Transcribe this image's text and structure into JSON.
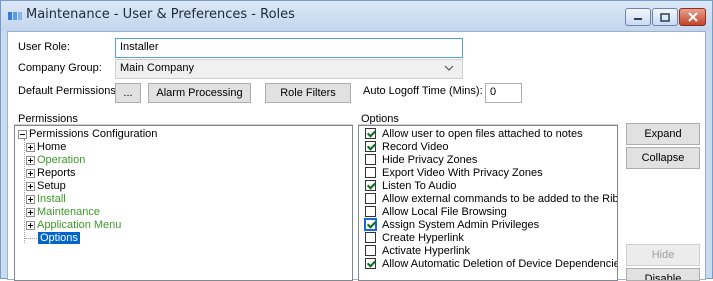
{
  "window": {
    "title": "Maintenance - User & Preferences - Roles",
    "accent": "#c9dbef"
  },
  "form": {
    "user_role_label": "User Role:",
    "user_role_value": "Installer",
    "company_group_label": "Company Group:",
    "company_group_value": "Main Company",
    "default_permissions_label": "Default Permissions",
    "ellipsis_label": "...",
    "alarm_processing_label": "Alarm Processing",
    "role_filters_label": "Role Filters",
    "auto_logoff_label": "Auto Logoff Time (Mins):",
    "auto_logoff_value": "0"
  },
  "permissions": {
    "title": "Permissions",
    "root": "Permissions Configuration",
    "nodes": [
      {
        "label": "Home",
        "green": false
      },
      {
        "label": "Operation",
        "green": true
      },
      {
        "label": "Reports",
        "green": false
      },
      {
        "label": "Setup",
        "green": false
      },
      {
        "label": "Install",
        "green": true
      },
      {
        "label": "Maintenance",
        "green": true
      },
      {
        "label": "Application Menu",
        "green": true
      }
    ],
    "selected": "Options"
  },
  "options": {
    "title": "Options",
    "items": [
      {
        "label": "Allow user to open files attached to notes",
        "checked": true
      },
      {
        "label": "Record Video",
        "checked": true
      },
      {
        "label": "Hide Privacy Zones",
        "checked": false
      },
      {
        "label": "Export Video With Privacy Zones",
        "checked": false
      },
      {
        "label": "Listen To Audio",
        "checked": true
      },
      {
        "label": "Allow external commands to be added to the Ribbon Bar",
        "checked": false
      },
      {
        "label": "Allow Local File Browsing",
        "checked": false
      },
      {
        "label": "Assign System Admin Privileges",
        "checked": true
      },
      {
        "label": "Create Hyperlink",
        "checked": false
      },
      {
        "label": "Activate Hyperlink",
        "checked": false
      },
      {
        "label": "Allow Automatic Deletion of Device Dependencies",
        "checked": true
      }
    ]
  },
  "side_buttons": {
    "expand": "Expand",
    "collapse": "Collapse",
    "hide": "Hide",
    "disable": "Disable"
  }
}
